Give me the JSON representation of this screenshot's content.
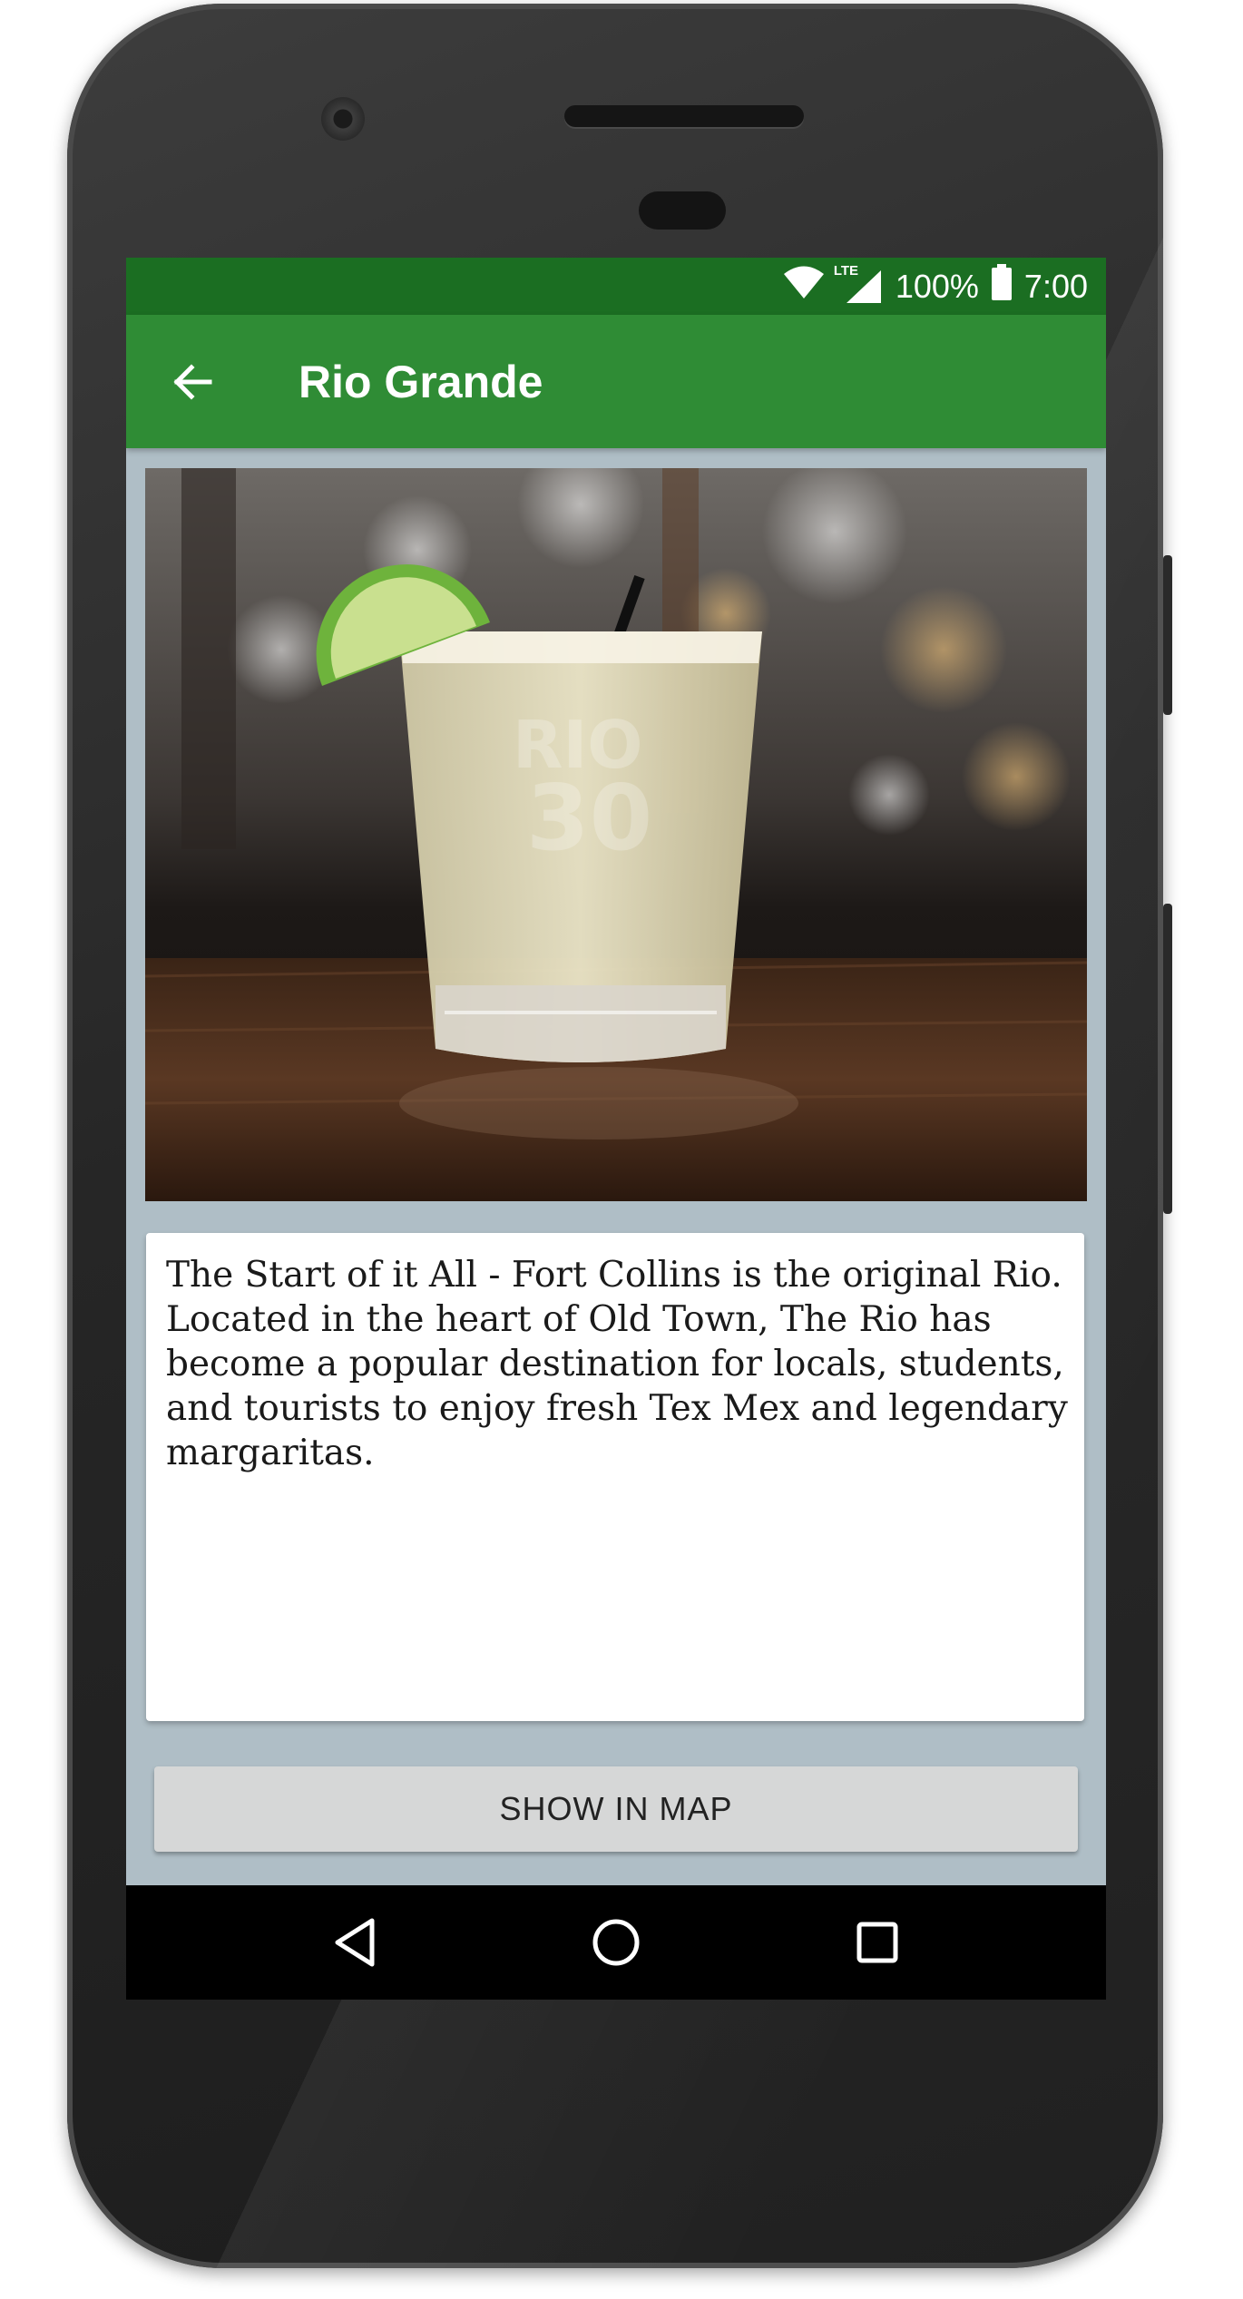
{
  "status_bar": {
    "network": "LTE",
    "battery": "100%",
    "time": "7:00"
  },
  "app_bar": {
    "title": "Rio Grande",
    "back_icon": "arrow-back-icon"
  },
  "content": {
    "image": "margarita-glass-photo",
    "description": "The Start of it All - Fort Collins is the original Rio. Located in the heart of Old Town, The Rio has become a popular destination for locals, students, and tourists to enjoy fresh Tex Mex and legendary margaritas.",
    "map_button_label": "SHOW IN MAP"
  },
  "nav_bar": {
    "back": "nav-back-icon",
    "home": "nav-home-icon",
    "recents": "nav-recents-icon"
  },
  "colors": {
    "status_bar": "#1b6e22",
    "app_bar": "#2f8c35",
    "screen_bg": "#afbec6",
    "button_bg": "#d6d7d7"
  }
}
